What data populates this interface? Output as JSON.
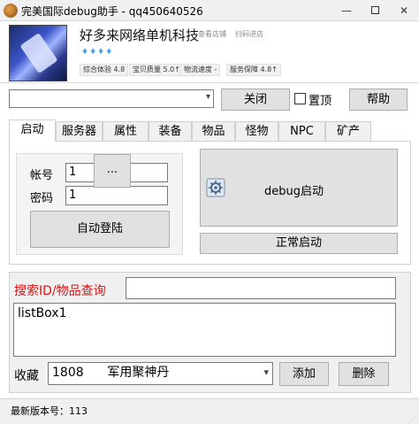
{
  "window": {
    "title": "完美国际debug助手 - qq450640526",
    "minimize_glyph": "—",
    "close_glyph": "✕"
  },
  "banner": {
    "shop_name": "好多来网络单机科技",
    "tag_follow": "查看店铺",
    "tag_scan": "扫码进店",
    "diamonds": "♦♦♦♦",
    "stats": [
      "综合体验 4.8",
      "宝贝质量 5.0↑",
      "物流速度 -",
      "服务保障 4.8↑"
    ]
  },
  "toolbar": {
    "close_label": "关闭",
    "topmost_label": "置顶",
    "help_label": "帮助",
    "combo_value": ""
  },
  "tabs": [
    "启动",
    "服务器",
    "属性",
    "装备",
    "物品",
    "怪物",
    "NPC",
    "矿产"
  ],
  "login": {
    "account_label": "帐号",
    "account_value": "1",
    "password_label": "密码",
    "password_value": "1",
    "ellipsis_label": "...",
    "auto_login_label": "自动登陆"
  },
  "launch": {
    "debug_label": "debug启动",
    "normal_label": "正常启动"
  },
  "search": {
    "label": "搜索ID/物品查询",
    "value": "",
    "listbox_text": "listBox1"
  },
  "favorites": {
    "label": "收藏",
    "selected": "1808      军用聚神丹",
    "add_label": "添加",
    "delete_label": "删除"
  },
  "status": {
    "text": "最新版本号：113"
  },
  "colors": {
    "search_label": "#e01010",
    "button_face": "#e1e1e1",
    "window_bg": "#f0f0f0"
  }
}
